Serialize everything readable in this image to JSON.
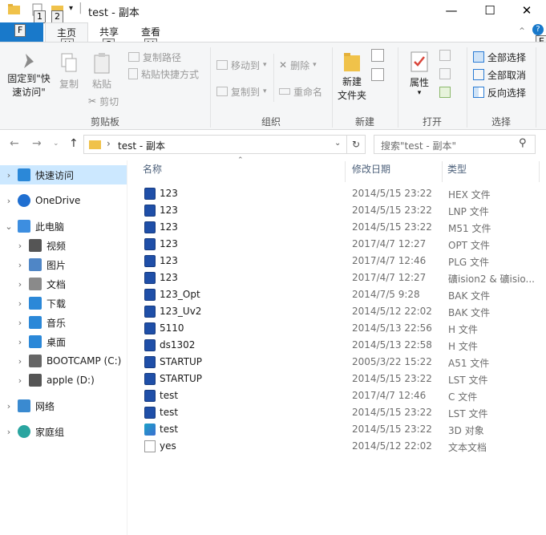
{
  "title": "test - 副本",
  "quick_access_keytips": [
    "1",
    "2"
  ],
  "tabs": {
    "file_keytip": "F",
    "home": "主页",
    "home_keytip": "H",
    "share": "共享",
    "share_keytip": "S",
    "view": "查看",
    "view_keytip": "V",
    "extra_keytip": "E"
  },
  "ribbon": {
    "pin": "固定到\"快\n速访问\"",
    "copy": "复制",
    "paste": "粘贴",
    "copy_path": "复制路径",
    "paste_shortcut": "粘贴快捷方式",
    "cut": "剪切",
    "clipboard": "剪贴板",
    "move_to": "移动到",
    "copy_to": "复制到",
    "delete": "删除",
    "rename": "重命名",
    "organize": "组织",
    "new_folder": "新建\n文件夹",
    "new": "新建",
    "properties": "属性",
    "open": "打开",
    "select_all": "全部选择",
    "select_none": "全部取消",
    "invert_selection": "反向选择",
    "select": "选择"
  },
  "address": {
    "path": "test - 副本",
    "search_placeholder": "搜索\"test - 副本\""
  },
  "nav": [
    {
      "label": "快速访问",
      "icon": "star-icon",
      "indent": 0,
      "selected": true,
      "chevron": "›"
    },
    {
      "label": "OneDrive",
      "icon": "cloud-icon",
      "indent": 0,
      "selected": false,
      "chevron": "›"
    },
    {
      "label": "此电脑",
      "icon": "computer-icon",
      "indent": 0,
      "selected": false,
      "chevron": "⌄"
    },
    {
      "label": "视频",
      "icon": "video-icon",
      "indent": 1,
      "selected": false,
      "chevron": "›"
    },
    {
      "label": "图片",
      "icon": "pictures-icon",
      "indent": 1,
      "selected": false,
      "chevron": "›"
    },
    {
      "label": "文档",
      "icon": "documents-icon",
      "indent": 1,
      "selected": false,
      "chevron": "›"
    },
    {
      "label": "下载",
      "icon": "download-icon",
      "indent": 1,
      "selected": false,
      "chevron": "›"
    },
    {
      "label": "音乐",
      "icon": "music-icon",
      "indent": 1,
      "selected": false,
      "chevron": "›"
    },
    {
      "label": "桌面",
      "icon": "desktop-icon",
      "indent": 1,
      "selected": false,
      "chevron": "›"
    },
    {
      "label": "BOOTCAMP (C:)",
      "icon": "drive-c-icon",
      "indent": 1,
      "selected": false,
      "chevron": "›"
    },
    {
      "label": "apple (D:)",
      "icon": "drive-d-icon",
      "indent": 1,
      "selected": false,
      "chevron": "›"
    },
    {
      "label": "网络",
      "icon": "network-icon",
      "indent": 0,
      "selected": false,
      "chevron": "›"
    },
    {
      "label": "家庭组",
      "icon": "homegroup-icon",
      "indent": 0,
      "selected": false,
      "chevron": "›"
    }
  ],
  "columns": {
    "name": "名称",
    "date": "修改日期",
    "type": "类型"
  },
  "files": [
    {
      "name": "123",
      "date": "2014/5/15 23:22",
      "type": "HEX 文件",
      "icon": "uvision-file-icon"
    },
    {
      "name": "123",
      "date": "2014/5/15 23:22",
      "type": "LNP 文件",
      "icon": "uvision-file-icon"
    },
    {
      "name": "123",
      "date": "2014/5/15 23:22",
      "type": "M51 文件",
      "icon": "uvision-file-icon"
    },
    {
      "name": "123",
      "date": "2017/4/7 12:27",
      "type": "OPT 文件",
      "icon": "uvision-file-icon"
    },
    {
      "name": "123",
      "date": "2017/4/7 12:46",
      "type": "PLG 文件",
      "icon": "uvision-file-icon"
    },
    {
      "name": "123",
      "date": "2017/4/7 12:27",
      "type": "礦ision2 & 礦isio...",
      "icon": "uvision-file-icon"
    },
    {
      "name": "123_Opt",
      "date": "2014/7/5 9:28",
      "type": "BAK 文件",
      "icon": "uvision-file-icon"
    },
    {
      "name": "123_Uv2",
      "date": "2014/5/12 22:02",
      "type": "BAK 文件",
      "icon": "uvision-file-icon"
    },
    {
      "name": "5110",
      "date": "2014/5/13 22:56",
      "type": "H 文件",
      "icon": "uvision-file-icon"
    },
    {
      "name": "ds1302",
      "date": "2014/5/13 22:58",
      "type": "H 文件",
      "icon": "uvision-file-icon"
    },
    {
      "name": "STARTUP",
      "date": "2005/3/22 15:22",
      "type": "A51 文件",
      "icon": "uvision-file-icon"
    },
    {
      "name": "STARTUP",
      "date": "2014/5/15 23:22",
      "type": "LST 文件",
      "icon": "uvision-file-icon"
    },
    {
      "name": "test",
      "date": "2017/4/7 12:46",
      "type": "C 文件",
      "icon": "uvision-file-icon"
    },
    {
      "name": "test",
      "date": "2014/5/15 23:22",
      "type": "LST 文件",
      "icon": "uvision-file-icon"
    },
    {
      "name": "test",
      "date": "2014/5/15 23:22",
      "type": "3D 对象",
      "icon": "3d-object-icon"
    },
    {
      "name": "yes",
      "date": "2014/5/12 22:02",
      "type": "文本文档",
      "icon": "text-file-icon"
    }
  ],
  "colors": {
    "accent": "#1979ca",
    "selection": "#cce8ff",
    "ribbon_bg": "#f5f6f7"
  }
}
